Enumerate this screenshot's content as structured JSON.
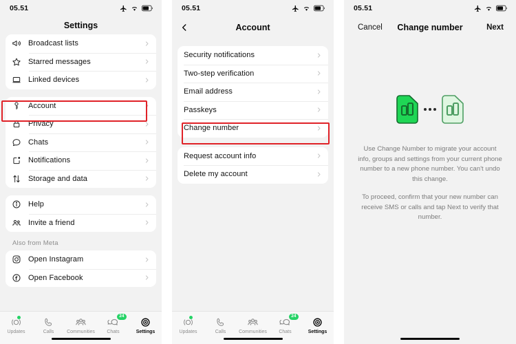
{
  "status_bar": {
    "time": "05.51",
    "icons": [
      "airplane-icon",
      "wifi-icon",
      "battery-icon"
    ]
  },
  "colors": {
    "accent_green": "#25d366",
    "highlight_red": "#e02127",
    "screen_bg": "#f2f2f2",
    "card_bg": "#ffffff"
  },
  "panel1": {
    "title": "Settings",
    "groups": [
      {
        "name": "communication",
        "items": [
          {
            "icon": "megaphone-icon",
            "label": "Broadcast lists"
          },
          {
            "icon": "star-icon",
            "label": "Starred messages"
          },
          {
            "icon": "laptop-icon",
            "label": "Linked devices"
          }
        ]
      },
      {
        "name": "account-settings",
        "items": [
          {
            "icon": "key-icon",
            "label": "Account"
          },
          {
            "icon": "lock-icon",
            "label": "Privacy"
          },
          {
            "icon": "chat-bubble-icon",
            "label": "Chats"
          },
          {
            "icon": "notification-icon",
            "label": "Notifications"
          },
          {
            "icon": "arrows-updown-icon",
            "label": "Storage and data"
          }
        ]
      },
      {
        "name": "support",
        "items": [
          {
            "icon": "info-icon",
            "label": "Help"
          },
          {
            "icon": "people-icon",
            "label": "Invite a friend"
          }
        ]
      }
    ],
    "meta_section_label": "Also from Meta",
    "meta_items": [
      {
        "icon": "instagram-icon",
        "label": "Open Instagram"
      },
      {
        "icon": "facebook-icon",
        "label": "Open Facebook"
      }
    ]
  },
  "panel2": {
    "title": "Account",
    "back_icon": "chevron-left-icon",
    "groups": [
      {
        "name": "security",
        "items": [
          {
            "label": "Security notifications"
          },
          {
            "label": "Two-step verification"
          },
          {
            "label": "Email address"
          },
          {
            "label": "Passkeys"
          },
          {
            "label": "Change number"
          }
        ]
      },
      {
        "name": "data",
        "items": [
          {
            "label": "Request account info"
          },
          {
            "label": "Delete my account"
          }
        ]
      }
    ]
  },
  "panel3": {
    "cancel_label": "Cancel",
    "title": "Change number",
    "next_label": "Next",
    "illustration": "two-sim-cards-icon",
    "paragraph1": "Use Change Number to migrate your account info, groups and settings from your current phone number to a new phone number. You can't undo this change.",
    "paragraph2": "To proceed, confirm that your new number can receive SMS or calls and tap Next to verify that number."
  },
  "tab_bar": {
    "tabs": [
      {
        "icon": "updates-icon",
        "label": "Updates",
        "active": false,
        "dot": true
      },
      {
        "icon": "calls-icon",
        "label": "Calls",
        "active": false
      },
      {
        "icon": "communities-icon",
        "label": "Communities",
        "active": false
      },
      {
        "icon": "chats-icon",
        "label": "Chats",
        "active": false,
        "badge": "24"
      },
      {
        "icon": "settings-icon",
        "label": "Settings",
        "active": true
      }
    ]
  }
}
